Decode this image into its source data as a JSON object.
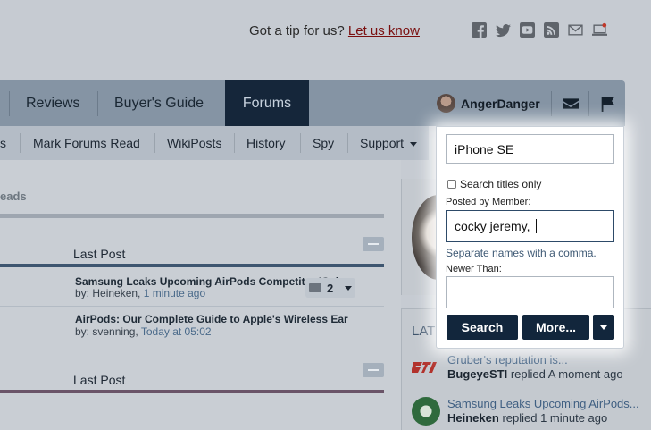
{
  "top": {
    "tip_text": "Got a tip for us?",
    "tip_link": "Let us know",
    "social_icons": [
      "facebook-icon",
      "twitter-icon",
      "youtube-icon",
      "rss-icon",
      "mail-icon",
      "laptop-icon"
    ]
  },
  "nav": {
    "items": [
      "Reviews",
      "Buyer's Guide",
      "Forums"
    ],
    "active": "Forums",
    "username": "AngerDanger"
  },
  "subnav": {
    "partial_first": "s",
    "items": [
      "Mark Forums Read",
      "WikiPosts",
      "History",
      "Spy"
    ],
    "support": "Support"
  },
  "content": {
    "threads_partial": "eads",
    "last_post_header": "Last Post",
    "last_post_header_2": "Last Post",
    "posts": [
      {
        "title": "Samsung Leaks Upcoming AirPods Competitor 'Galax",
        "by": "by:",
        "author": "Heineken,",
        "time": "1 minute ago"
      },
      {
        "title": "AirPods: Our Complete Guide to Apple's Wireless Ear",
        "by": "by:",
        "author": "svenning,",
        "time": "Today at 05:02"
      }
    ],
    "reply_count": "2"
  },
  "sidebar": {
    "latest_label": "LAT",
    "feed": [
      {
        "link": "Gruber's reputation is...",
        "who": "BugeyeSTI",
        "action": "replied A moment ago"
      },
      {
        "link": "Samsung Leaks Upcoming AirPods...",
        "who": "Heineken",
        "action": "replied 1 minute ago"
      }
    ]
  },
  "search_popup": {
    "query_value": "iPhone SE",
    "titles_only_label": "Search titles only",
    "titles_only_checked": false,
    "posted_by_label": "Posted by Member:",
    "posted_by_value": "cocky jeremy,",
    "names_hint": "Separate names with a comma.",
    "newer_than_label": "Newer Than:",
    "newer_than_value": "",
    "search_button": "Search",
    "more_button": "More..."
  },
  "colors": {
    "nav_bg": "#8594a4",
    "nav_active": "#15263a",
    "button": "#12263c",
    "link_red": "#7a0f0f"
  }
}
